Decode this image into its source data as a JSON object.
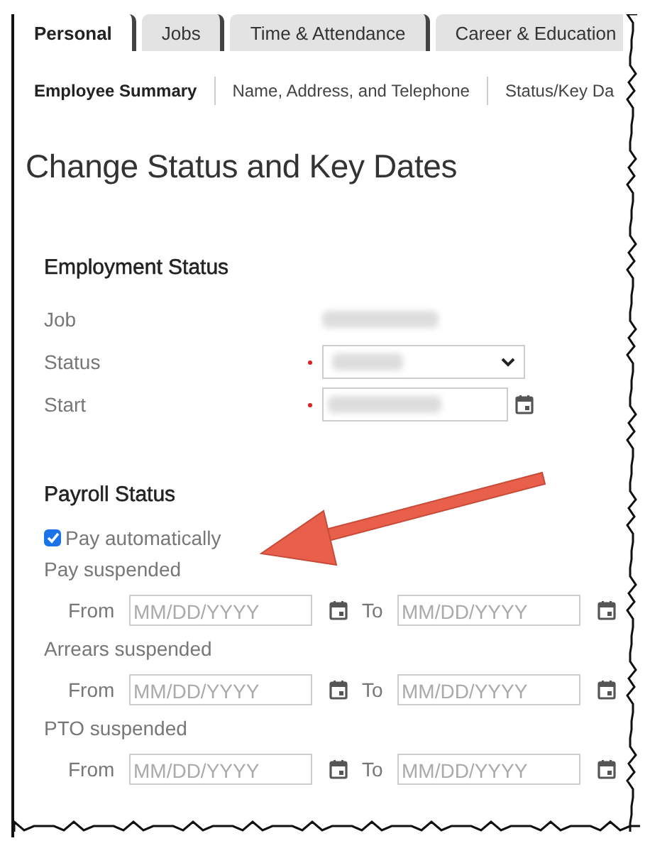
{
  "tabs": [
    {
      "label": "Personal",
      "selected": true
    },
    {
      "label": "Jobs",
      "selected": false
    },
    {
      "label": "Time & Attendance",
      "selected": false
    },
    {
      "label": "Career & Education",
      "selected": false
    }
  ],
  "subnav": [
    {
      "label": "Employee Summary",
      "selected": true
    },
    {
      "label": "Name, Address, and Telephone",
      "selected": false
    },
    {
      "label": "Status/Key Da",
      "selected": false
    }
  ],
  "page_title": "Change Status and Key Dates",
  "employment_status": {
    "heading": "Employment Status",
    "fields": [
      {
        "label": "Job",
        "kind": "text",
        "required": false
      },
      {
        "label": "Status",
        "kind": "select",
        "required": true
      },
      {
        "label": "Start",
        "kind": "date",
        "required": true
      }
    ]
  },
  "payroll_status": {
    "heading": "Payroll Status",
    "pay_automatically": {
      "label": "Pay automatically",
      "checked": true
    },
    "suspensions": [
      {
        "label": "Pay suspended",
        "from_label": "From",
        "from_placeholder": "MM/DD/YYYY",
        "to_label": "To",
        "to_placeholder": "MM/DD/YYYY"
      },
      {
        "label": "Arrears suspended",
        "from_label": "From",
        "from_placeholder": "MM/DD/YYYY",
        "to_label": "To",
        "to_placeholder": "MM/DD/YYYY"
      },
      {
        "label": "PTO suspended",
        "from_label": "From",
        "from_placeholder": "MM/DD/YYYY",
        "to_label": "To",
        "to_placeholder": "MM/DD/YYYY"
      }
    ]
  }
}
